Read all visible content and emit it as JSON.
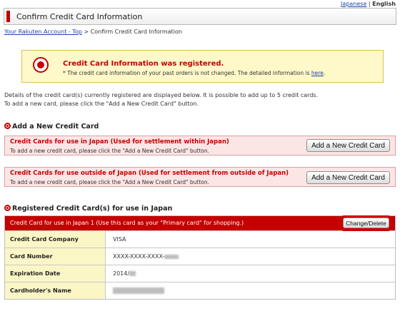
{
  "lang": {
    "japanese": "Japanese",
    "separator": "|",
    "english": "English"
  },
  "header": {
    "title": "Confirm Credit Card Information"
  },
  "breadcrumb": {
    "top_link": "Your Rakuten Account - Top",
    "separator": ">",
    "current": "Confirm Credit Card Information"
  },
  "notice": {
    "title": "Credit Card Information was registered.",
    "text": "* The credit card information of your past orders is not changed. The detailed information is",
    "link": "here",
    "end": "."
  },
  "intro": {
    "line1": "Details of the credit card(s) currently registered are displayed below. It is possible to add up to 5 credit cards.",
    "line2": "To add a new card, please click the \"Add a New Credit Card\" button."
  },
  "add_section": {
    "heading": "Add a New Credit Card",
    "japan": {
      "title": "Credit Cards for use in Japan (Used for settlement within Japan)",
      "sub": "To add a new credit card, please click the \"Add a New Credit Card\" button.",
      "button": "Add a New Credit Card"
    },
    "outside": {
      "title": "Credit Cards for use outside of Japan (Used for settlement from outside of Japan)",
      "sub": "To add a new credit card, please click the \"Add a New Credit Card\" button.",
      "button": "Add a New Credit Card"
    }
  },
  "registered": {
    "heading": "Registered Credit Card(s) for use in Japan",
    "card_header": "Credit Card for use in Japan 1 (Use this card as your \"Primary card\" for shopping.)",
    "change_button": "Change/Delete",
    "rows": [
      {
        "label": "Credit Card Company",
        "value": "VISA"
      },
      {
        "label": "Card Number",
        "value": "XXXX-XXXX-XXXX-"
      },
      {
        "label": "Expiration Date",
        "value": "2014/"
      },
      {
        "label": "Cardholder's Name",
        "value": ""
      }
    ]
  },
  "colors": {
    "accent_red": "#c40000",
    "notice_bg": "#fff8c8",
    "label_bg": "#fbf6c6",
    "add_box_bg": "#fbe5e5"
  }
}
